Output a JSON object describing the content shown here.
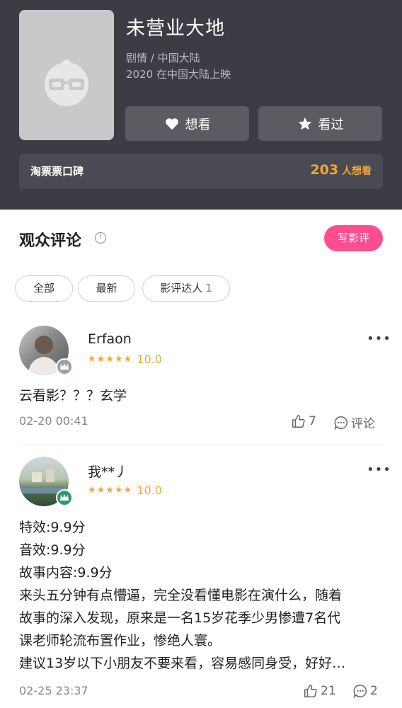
{
  "movie": {
    "title": "未营业大地",
    "genre_region": "剧情 / 中国大陆",
    "release": "2020 在中国大陆上映",
    "want_label": "想看",
    "seen_label": "看过",
    "reputation_label": "淘票票口碑",
    "want_count": "203",
    "want_suffix": "人想看"
  },
  "comments_section": {
    "title": "观众评论",
    "write_label": "写影评",
    "filters": [
      {
        "label": "全部"
      },
      {
        "label": "最新"
      },
      {
        "label": "影评达人",
        "count": "1"
      }
    ]
  },
  "comments": [
    {
      "user": "Erfaon",
      "stars": "★★★★★",
      "score": "10.0",
      "text": [
        "云看影？？？玄学"
      ],
      "date": "02-20 00:41",
      "likes": "7",
      "reply_label": "评论"
    },
    {
      "user": "我**丿",
      "stars": "★★★★★",
      "score": "10.0",
      "text": [
        "特效:9.9分",
        "音效:9.9分",
        "故事内容:9.9分",
        "来头五分钟有点懵逼，完全没看懂电影在演什么，随着",
        "故事的深入发现，原来是一名15岁花季少男惨遭7名代",
        "课老师轮流布置作业，惨绝人寰。",
        "建议13岁以下小朋友不要来看，容易感同身受，好好…"
      ],
      "date": "02-25 23:37",
      "likes": "21",
      "replies": "2"
    }
  ],
  "colors": {
    "header_bg": "#3c3c44",
    "accent_orange": "#f0a83a",
    "accent_pink": "#ff4d8d"
  }
}
